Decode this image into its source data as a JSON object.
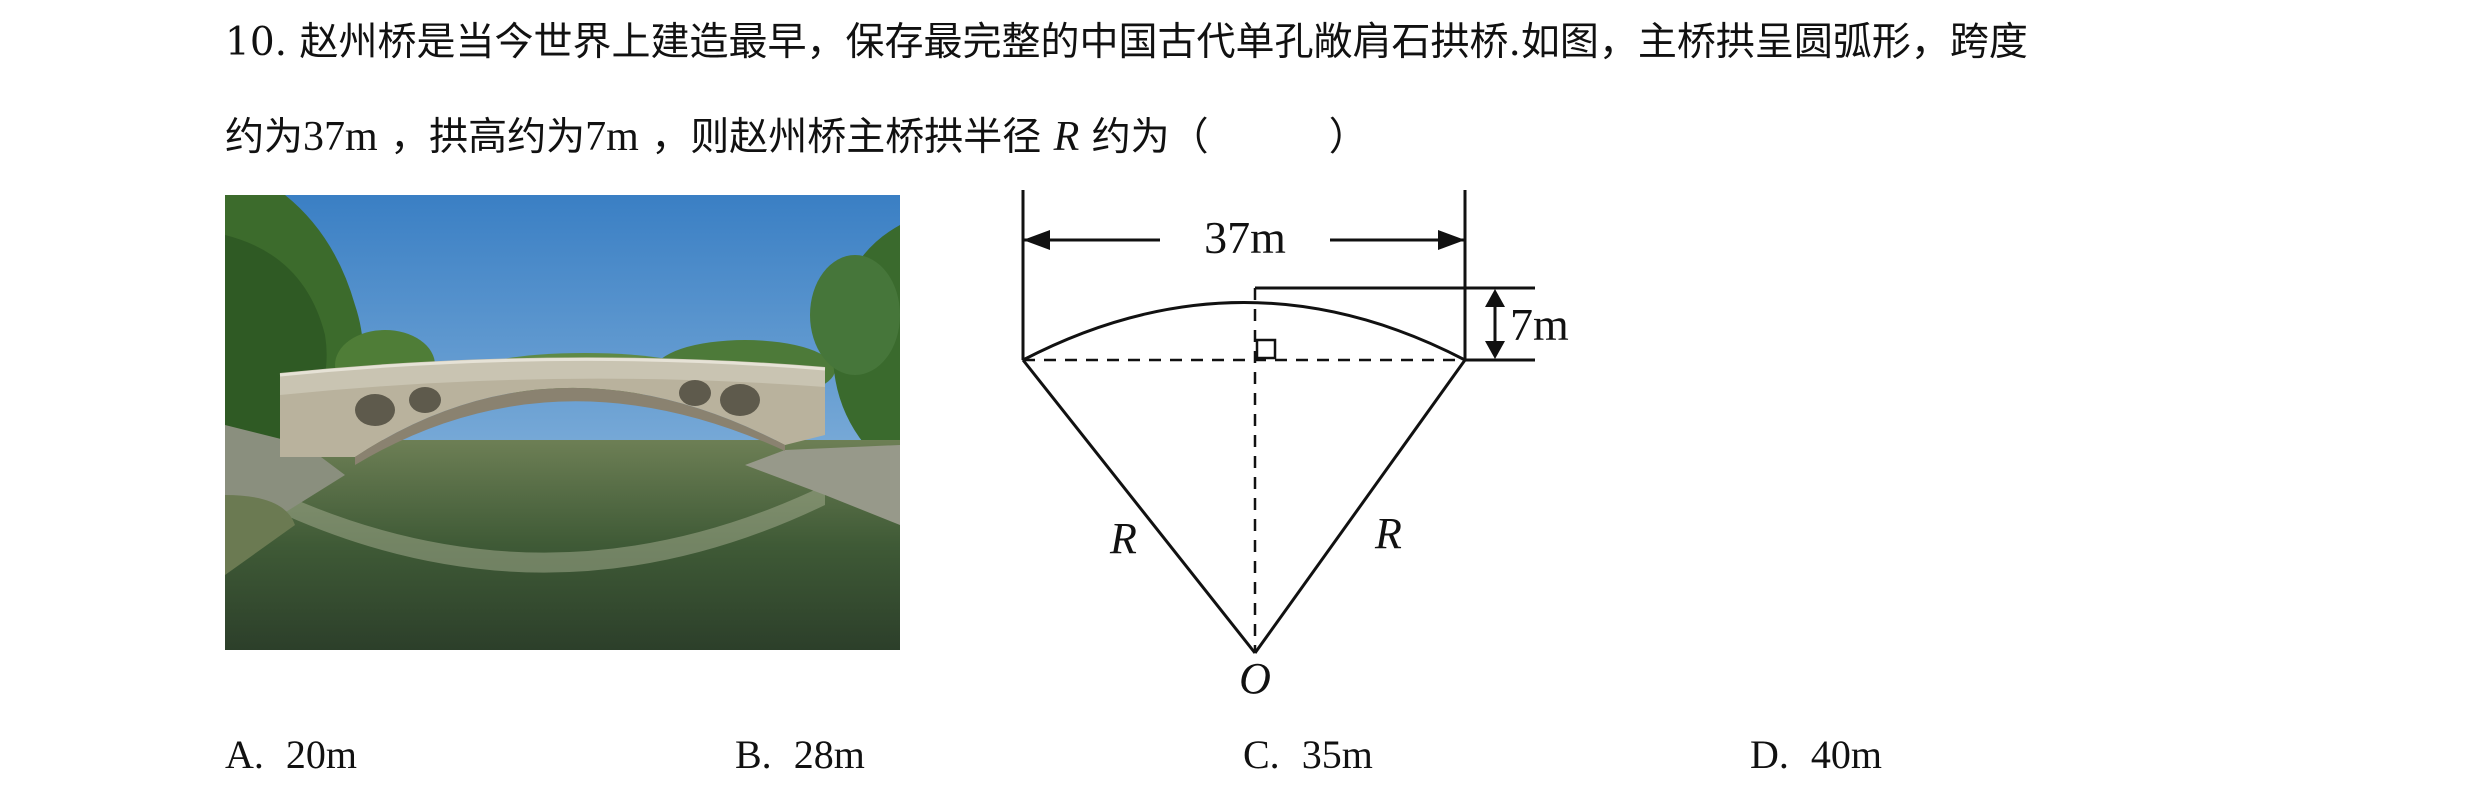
{
  "question": {
    "number": "10.",
    "line1": "赵州桥是当今世界上建造最早，保存最完整的中国古代单孔敞肩石拱桥.如图，主桥拱呈圆弧形，跨度",
    "line2_a": "约为",
    "span_value": "37",
    "unit_m": "m",
    "line2_b": "，拱高约为",
    "height_value": "7",
    "line2_c": "，则赵州桥主桥拱半径",
    "radius_symbol": "R",
    "line2_d": "约为（",
    "line2_e": "）"
  },
  "diagram": {
    "span_label": "37m",
    "height_label": "7m",
    "radius_left": "R",
    "radius_right": "R",
    "center_label": "O"
  },
  "options": [
    {
      "letter": "A.",
      "value": "20m"
    },
    {
      "letter": "B.",
      "value": "28m"
    },
    {
      "letter": "C.",
      "value": "35m"
    },
    {
      "letter": "D.",
      "value": "40m"
    }
  ]
}
